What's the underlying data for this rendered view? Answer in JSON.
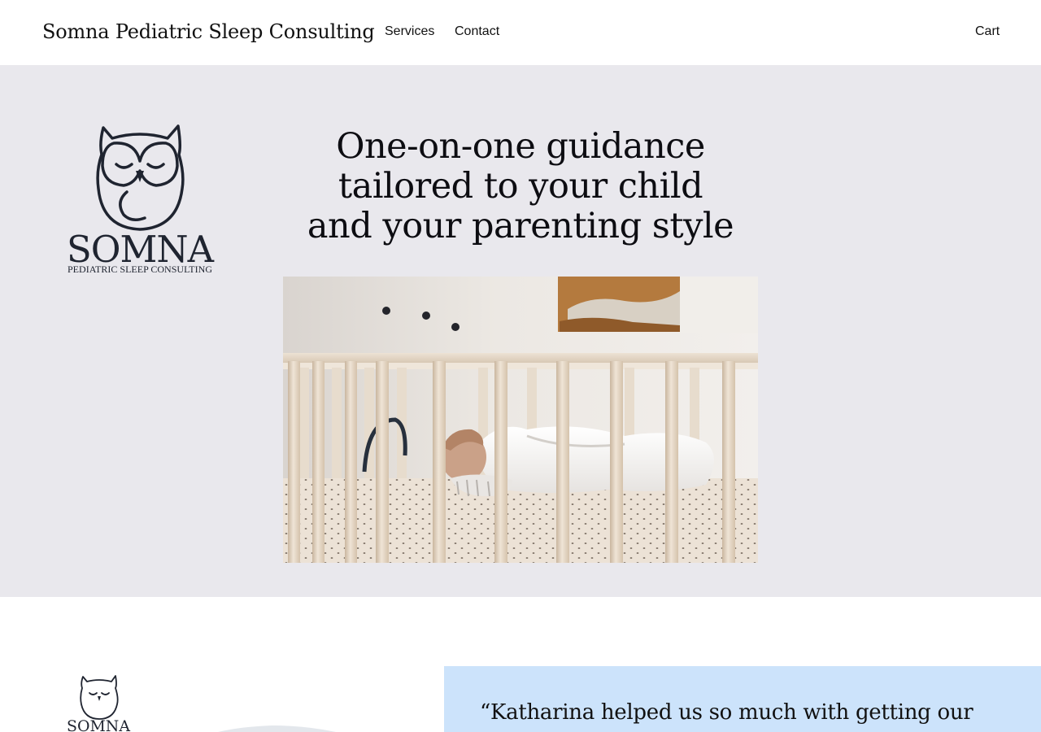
{
  "header": {
    "site_title": "Somna Pediatric Sleep Consulting",
    "nav": [
      {
        "label": "Services"
      },
      {
        "label": "Contact"
      }
    ],
    "cart_label": "Cart"
  },
  "hero": {
    "logo": {
      "brand": "SOMNA",
      "tagline": "PEDIATRIC SLEEP CONSULTING"
    },
    "heading_lines": [
      "One-on-one guidance",
      "tailored to your child",
      "and your parenting style"
    ],
    "image_description": "baby sleeping in a wooden crib"
  },
  "lower": {
    "logo_brand": "SOMNA",
    "testimonial_text": "“Katharina helped us so much with getting our ten"
  },
  "colors": {
    "hero_bg": "#e9e8ed",
    "testimonial_bg": "#cce3fb",
    "text": "#111111",
    "logo_ink": "#1f2430"
  }
}
